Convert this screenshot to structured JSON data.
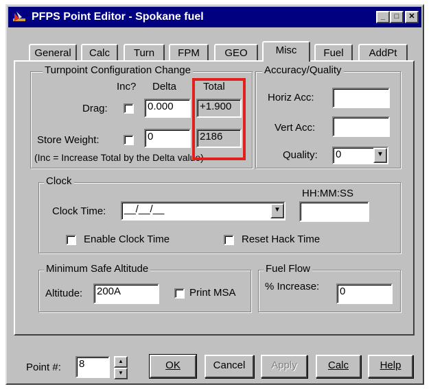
{
  "window": {
    "title": "PFPS Point Editor - Spokane fuel",
    "minimize_icon": "minimize-icon",
    "maximize_icon": "maximize-icon",
    "close_icon": "close-icon"
  },
  "tabs": [
    {
      "label": "General"
    },
    {
      "label": "Calc"
    },
    {
      "label": "Turn"
    },
    {
      "label": "FPM"
    },
    {
      "label": "GEO"
    },
    {
      "label": "Misc",
      "active": true
    },
    {
      "label": "Fuel"
    },
    {
      "label": "AddPt"
    }
  ],
  "turnpoint": {
    "group_title": "Turnpoint Configuration Change",
    "col_inc": "Inc?",
    "col_delta": "Delta",
    "col_total": "Total",
    "drag_label": "Drag:",
    "drag_delta": "0.000",
    "drag_total": "+1.900",
    "store_label": "Store Weight:",
    "store_delta": "0",
    "store_total": "2186",
    "note": "(Inc = Increase Total by the Delta value)"
  },
  "accuracy": {
    "group_title": "Accuracy/Quality",
    "horiz_label": "Horiz Acc:",
    "horiz_value": "",
    "vert_label": "Vert Acc:",
    "vert_value": "",
    "quality_label": "Quality:",
    "quality_value": "0"
  },
  "clock": {
    "group_title": "Clock",
    "time_label": "Clock Time:",
    "date_value": "__/__/__",
    "hhmmss_label": "HH:MM:SS",
    "time_value": "",
    "enable_label": "Enable Clock Time",
    "reset_label": "Reset Hack Time"
  },
  "msa": {
    "group_title": "Minimum Safe Altitude",
    "altitude_label": "Altitude:",
    "altitude_value": "200A",
    "print_label": "Print MSA"
  },
  "fuelflow": {
    "group_title": "Fuel Flow",
    "increase_label": "% Increase:",
    "increase_value": "0"
  },
  "footer": {
    "point_label": "Point #:",
    "point_value": "8",
    "ok": "OK",
    "cancel": "Cancel",
    "apply": "Apply",
    "calc": "Calc",
    "help": "Help"
  },
  "colors": {
    "titlebar": "#000080",
    "face": "#c0c0c0",
    "highlight_box": "#e0201c"
  }
}
